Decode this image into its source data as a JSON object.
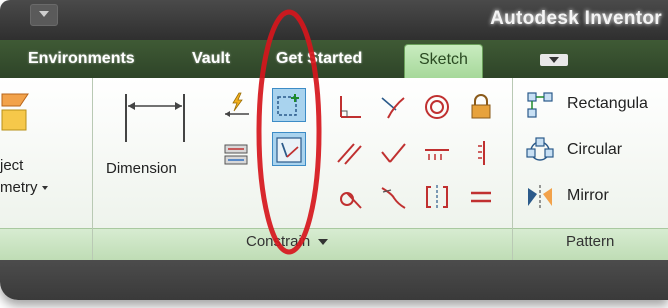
{
  "app": {
    "title": "Autodesk Inventor"
  },
  "tabs": [
    {
      "label": "Environments",
      "active": false
    },
    {
      "label": "Vault",
      "active": false
    },
    {
      "label": "Get Started",
      "active": false
    },
    {
      "label": "Sketch",
      "active": true
    }
  ],
  "project_geometry": {
    "label_line1": "ject",
    "label_line2": "metry"
  },
  "dimension": {
    "label": "Dimension"
  },
  "panels": {
    "constrain": {
      "label": "Constrain"
    },
    "pattern": {
      "label": "Pattern"
    }
  },
  "pattern_items": [
    {
      "label": "Rectangula"
    },
    {
      "label": "Circular"
    },
    {
      "label": "Mirror"
    }
  ],
  "icons": {
    "constraint_grid": [
      "perpendicular-icon",
      "tangent-icon",
      "concentric-icon",
      "fix-icon",
      "parallel-icon",
      "coincident-icon",
      "horizontal-icon",
      "vertical-icon",
      "smooth-icon",
      "collinear-icon",
      "symmetric-icon",
      "equal-icon"
    ],
    "left_small": [
      "auto-dimension-icon",
      "show-constraints-icon"
    ],
    "highlighted": [
      "show-constraint-icon",
      "constraint-settings-icon"
    ]
  },
  "colors": {
    "accent_green": "#a6d89a",
    "selection_blue": "#a9d3ee",
    "annotation_red": "#d6161c"
  }
}
